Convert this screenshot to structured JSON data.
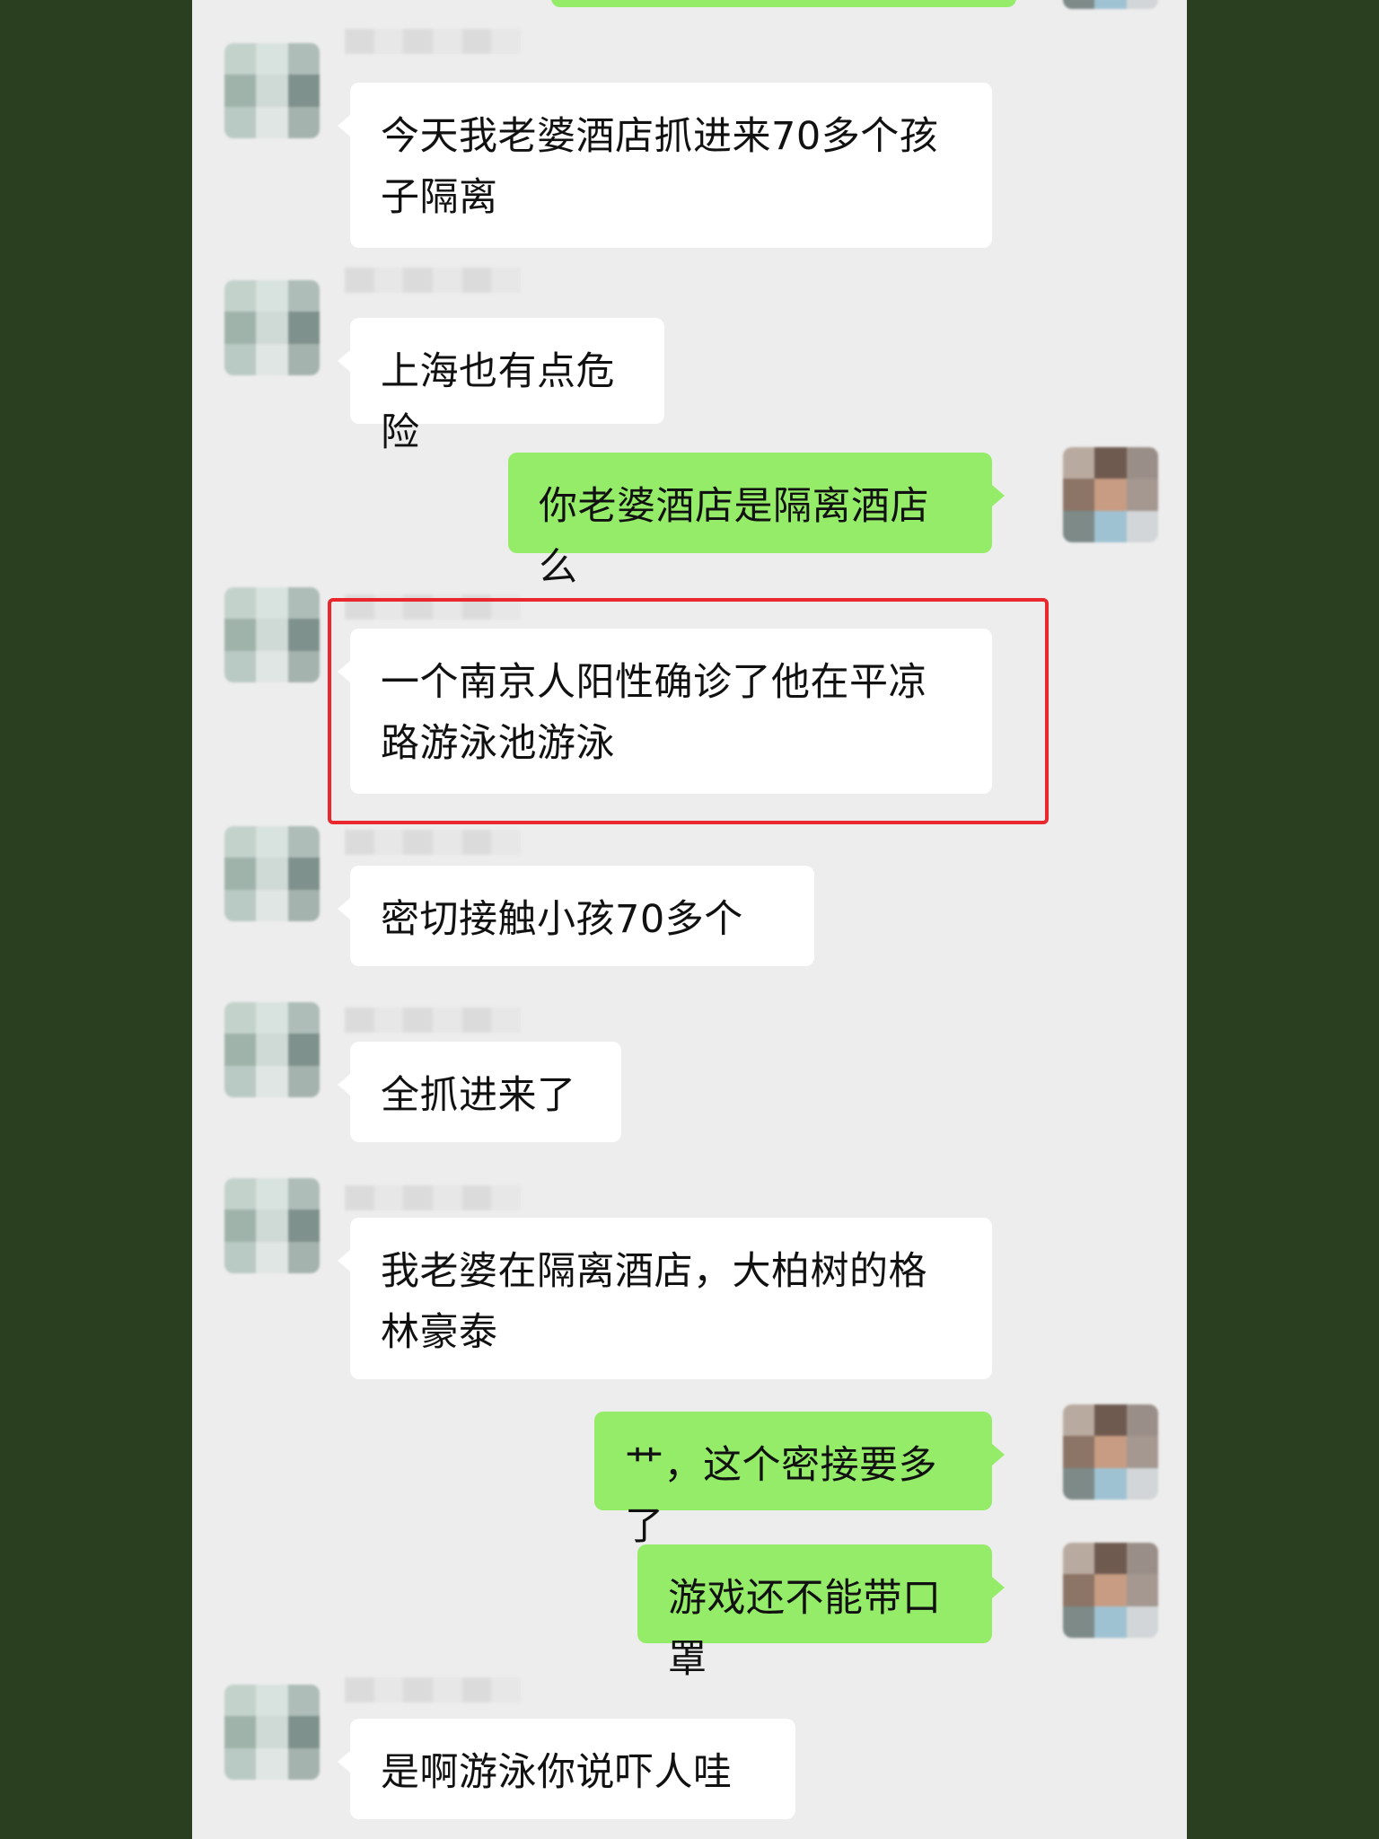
{
  "chat": {
    "messages": [
      {
        "side": "friend",
        "text": "今天我老婆酒店抓进来70多个孩子隔离"
      },
      {
        "side": "friend",
        "text": "上海也有点危险"
      },
      {
        "side": "me",
        "text": "你老婆酒店是隔离酒店么"
      },
      {
        "side": "friend",
        "text": "一个南京人阳性确诊了他在平凉路游泳池游泳",
        "highlighted": true
      },
      {
        "side": "friend",
        "text": "密切接触小孩70多个"
      },
      {
        "side": "friend",
        "text": "全抓进来了"
      },
      {
        "side": "friend",
        "text": "我老婆在隔离酒店，大柏树的格林豪泰"
      },
      {
        "side": "me",
        "text": "艹，这个密接要多了"
      },
      {
        "side": "me",
        "text": "游戏还不能带口罩"
      },
      {
        "side": "friend",
        "text": "是啊游泳你说吓人哇"
      }
    ],
    "colors": {
      "friend_bubble": "#ffffff",
      "me_bubble": "#95ec69",
      "highlight": "#e8282d",
      "chat_background": "#ededed",
      "outer_background": "#2a3f1f"
    }
  }
}
